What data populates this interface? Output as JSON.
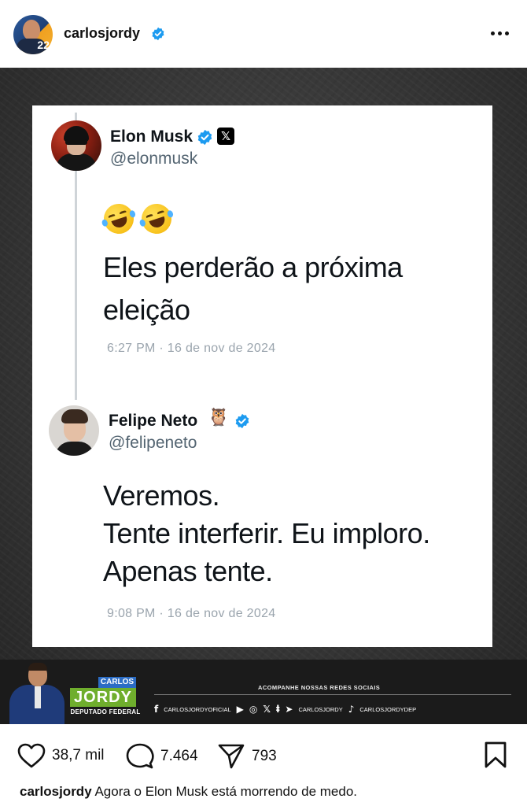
{
  "header": {
    "username": "carlosjordy",
    "avatar_number": "22"
  },
  "tweets": [
    {
      "name": "Elon Musk",
      "handle": "@elonmusk",
      "x_badge": "𝕏",
      "emoji": "🤣🤣",
      "lines": [
        "Eles perderão a próxima",
        "eleição"
      ],
      "timestamp": "6:27 PM · 16 de nov de 2024"
    },
    {
      "name": "Felipe Neto",
      "handle": "@felipeneto",
      "owl": "🦉",
      "lines": [
        "Veremos.",
        "Tente interferir. Eu imploro.",
        "Apenas tente."
      ],
      "timestamp": "9:08 PM · 16 de nov de 2024"
    }
  ],
  "banner": {
    "logo_top": "CARLOS",
    "logo_main": "JORDY",
    "logo_sub": "DEPUTADO FEDERAL",
    "follow_title": "ACOMPANHE NOSSAS REDES SOCIAIS",
    "facebook": "CARLOSJORDYOFICIAL",
    "twitter_handle": "CARLOSJORDY",
    "tiktok": "CARLOSJORDYDEP"
  },
  "actions": {
    "likes": "38,7 mil",
    "comments": "7.464",
    "shares": "793"
  },
  "caption": {
    "username": "carlosjordy",
    "text": "Agora o Elon Musk está morrendo de medo."
  },
  "colors": {
    "verified": "#1d9bf0",
    "card_bg": "#ffffff",
    "image_bg": "#363636",
    "jordy_green": "#6fae2d",
    "carlos_blue": "#2b6cc4"
  }
}
